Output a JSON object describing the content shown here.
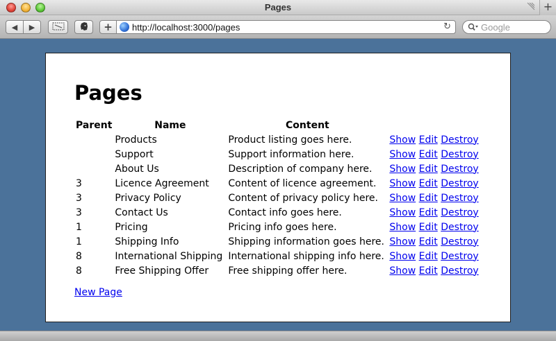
{
  "window": {
    "title": "Pages"
  },
  "toolbar": {
    "back_glyph": "◀",
    "forward_glyph": "▶",
    "add_glyph": "+",
    "url": "http://localhost:3000/pages",
    "reload_glyph": "↻",
    "search_placeholder": "Google",
    "new_tab_glyph": "+"
  },
  "page": {
    "heading": "Pages",
    "columns": [
      "Parent",
      "Name",
      "Content"
    ],
    "rows": [
      {
        "parent": "",
        "name": "Products",
        "content": "Product listing goes here."
      },
      {
        "parent": "",
        "name": "Support",
        "content": "Support information here."
      },
      {
        "parent": "",
        "name": "About Us",
        "content": "Description of company here."
      },
      {
        "parent": "3",
        "name": "Licence Agreement",
        "content": "Content of licence agreement."
      },
      {
        "parent": "3",
        "name": "Privacy Policy",
        "content": "Content of privacy policy here."
      },
      {
        "parent": "3",
        "name": "Contact Us",
        "content": "Contact info goes here."
      },
      {
        "parent": "1",
        "name": "Pricing",
        "content": "Pricing info goes here."
      },
      {
        "parent": "1",
        "name": "Shipping Info",
        "content": "Shipping information goes here."
      },
      {
        "parent": "8",
        "name": "International Shipping",
        "content": "International shipping info here."
      },
      {
        "parent": "8",
        "name": "Free Shipping Offer",
        "content": "Free shipping offer here."
      }
    ],
    "actions": {
      "show": "Show",
      "edit": "Edit",
      "destroy": "Destroy"
    },
    "new_link": "New Page"
  },
  "colors": {
    "desktop": "#4b729a",
    "link": "#0000ee"
  }
}
